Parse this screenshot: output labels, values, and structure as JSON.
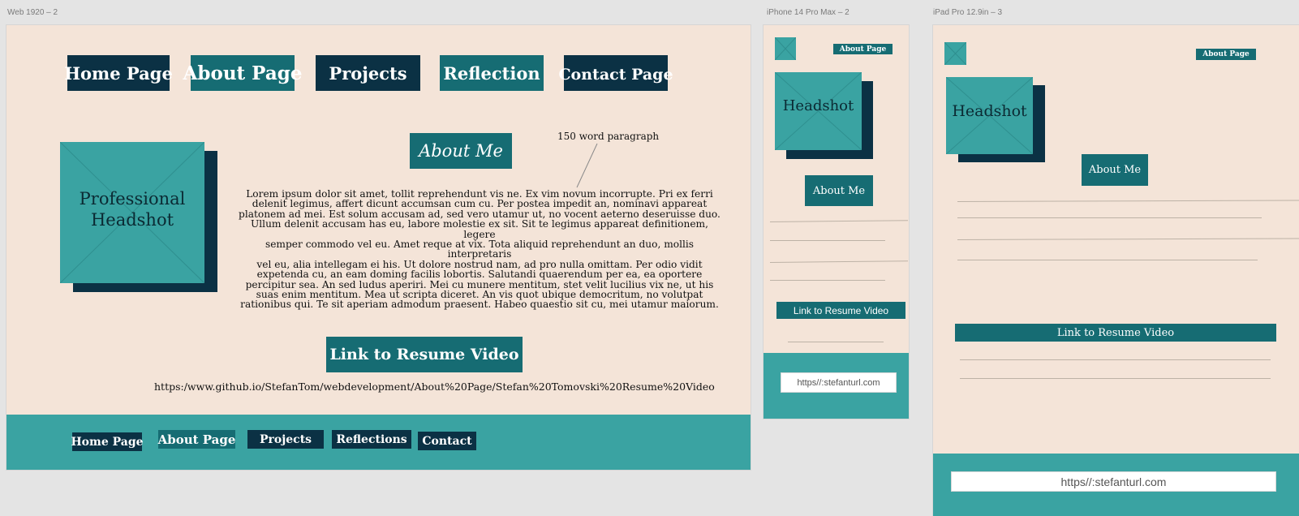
{
  "artboards": {
    "web_label": "Web 1920 – 2",
    "phone_label": "iPhone 14 Pro Max – 2",
    "ipad_label": "iPad Pro 12.9in – 3"
  },
  "colors": {
    "background": "#f4e4d8",
    "teal": "#166c73",
    "navy": "#0b3144",
    "light_teal": "#3aa3a2"
  },
  "web": {
    "nav": [
      "Home Page",
      "About Page",
      "Projects",
      "Reflection",
      "Contact Page"
    ],
    "headshot_label_line1": "Professional",
    "headshot_label_line2": "Headshot",
    "about_heading": "About Me",
    "annotation": "150 word paragraph",
    "paragraph_lines": [
      "Lorem ipsum dolor sit amet, tollit reprehendunt vis ne. Ex vim novum incorrupte. Pri ex ferri",
      "delenit legimus, affert dicunt accumsan cum cu. Per postea impedit an, nominavi appareat",
      "platonem ad mei. Est solum accusam ad, sed vero utamur ut, no vocent aeterno deseruisse duo.",
      "Ullum delenit accusam has eu, labore molestie ex sit. Sit te legimus appareat definitionem, legere",
      "semper commodo vel eu. Amet reque at vix. Tota aliquid reprehendunt an duo, mollis interpretaris",
      "vel eu, alia intellegam ei his. Ut dolore nostrud nam, ad pro nulla omittam. Per odio vidit",
      "expetenda cu, an eam doming facilis lobortis. Salutandi quaerendum per ea, ea oportere",
      "percipitur sea. An sed ludus aperiri. Mei cu munere mentitum, stet velit lucilius vix ne, ut his",
      "suas enim mentitum. Mea ut scripta diceret. An vis quot ubique democritum, no volutpat",
      "rationibus qui. Te sit aperiam admodum praesent. Habeo quaestio sit cu, mei utamur maiorum."
    ],
    "resume_button": "Link to Resume Video",
    "resume_url": "https:/www.github.io/StefanTom/webdevelopment/About%20Page/Stefan%20Tomovski%20Resume%20Video",
    "footer_nav": [
      "Home Page",
      "About Page",
      "Projects",
      "Reflections",
      "Contact"
    ]
  },
  "phone": {
    "nav_label": "About Page",
    "headshot_label": "Headshot",
    "about_heading": "About Me",
    "resume_button": "Link to Resume Video",
    "url_placeholder": "https//:stefanturl.com"
  },
  "ipad": {
    "nav_label": "About Page",
    "headshot_label": "Headshot",
    "about_heading": "About Me",
    "resume_button": "Link to Resume Video",
    "url_placeholder": "https//:stefanturl.com"
  }
}
